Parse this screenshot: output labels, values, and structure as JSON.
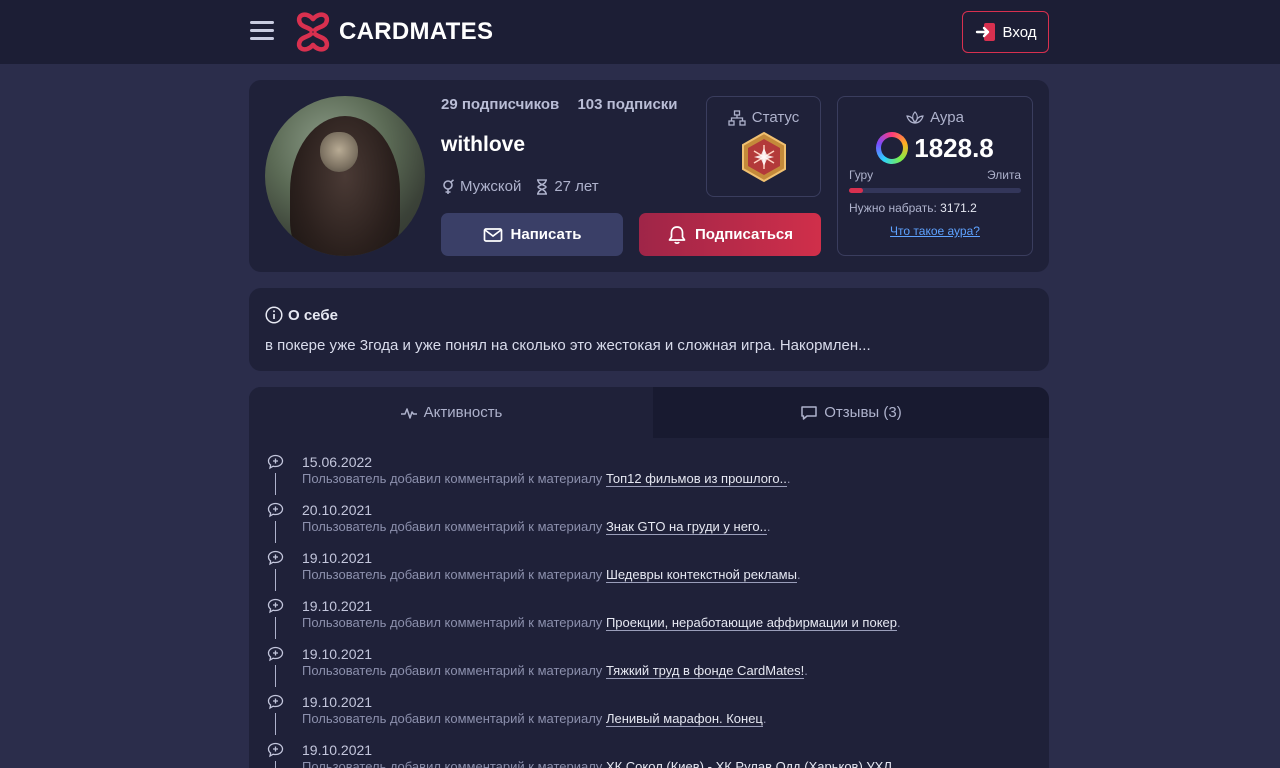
{
  "header": {
    "brand": "CARDMATES",
    "login_label": "Вход"
  },
  "profile": {
    "followers": "29 подписчиков",
    "following": "103 подписки",
    "username": "withlove",
    "gender": "Мужской",
    "age": "27 лет",
    "write_label": "Написать",
    "subscribe_label": "Подписаться"
  },
  "status": {
    "title": "Статус"
  },
  "aura": {
    "title": "Аура",
    "value": "1828.8",
    "level_from": "Гуру",
    "level_to": "Элита",
    "progress": 0.08,
    "need_label": "Нужно набрать:",
    "need_value": "3171.2",
    "link_label": "Что такое аура?"
  },
  "about": {
    "title": "О себе",
    "text": "в покере уже 3года и уже понял на сколько это жестокая и сложная игра. Накормлен..."
  },
  "tabs": {
    "activity": "Активность",
    "reviews": "Отзывы (3)"
  },
  "feed": [
    {
      "date": "15.06.2022",
      "prefix": "Пользователь добавил комментарий к материалу",
      "link": "Топ12 фильмов из прошлого..",
      "suffix": "."
    },
    {
      "date": "20.10.2021",
      "prefix": "Пользователь добавил комментарий к материалу",
      "link": "Знак GTO на груди у него..",
      "suffix": "."
    },
    {
      "date": "19.10.2021",
      "prefix": "Пользователь добавил комментарий к материалу",
      "link": "Шедевры контекстной рекламы",
      "suffix": "."
    },
    {
      "date": "19.10.2021",
      "prefix": "Пользователь добавил комментарий к материалу",
      "link": "Проекции, неработающие аффирмации и покер",
      "suffix": "."
    },
    {
      "date": "19.10.2021",
      "prefix": "Пользователь добавил комментарий к материалу",
      "link": "Тяжкий труд в фонде CardMates!",
      "suffix": "."
    },
    {
      "date": "19.10.2021",
      "prefix": "Пользователь добавил комментарий к материалу",
      "link": "Ленивый марафон. Конец",
      "suffix": "."
    },
    {
      "date": "19.10.2021",
      "prefix": "Пользователь добавил комментарий к материалу",
      "link": "ХК Сокол (Киев) - ХК Рулав Одд (Харьков) УХЛ",
      "suffix": ""
    }
  ],
  "colors": {
    "accent": "#d8304f",
    "background": "#2b2d4b",
    "card": "#1f2139",
    "topbar": "#1c1e35",
    "link": "#5ea2ff"
  }
}
